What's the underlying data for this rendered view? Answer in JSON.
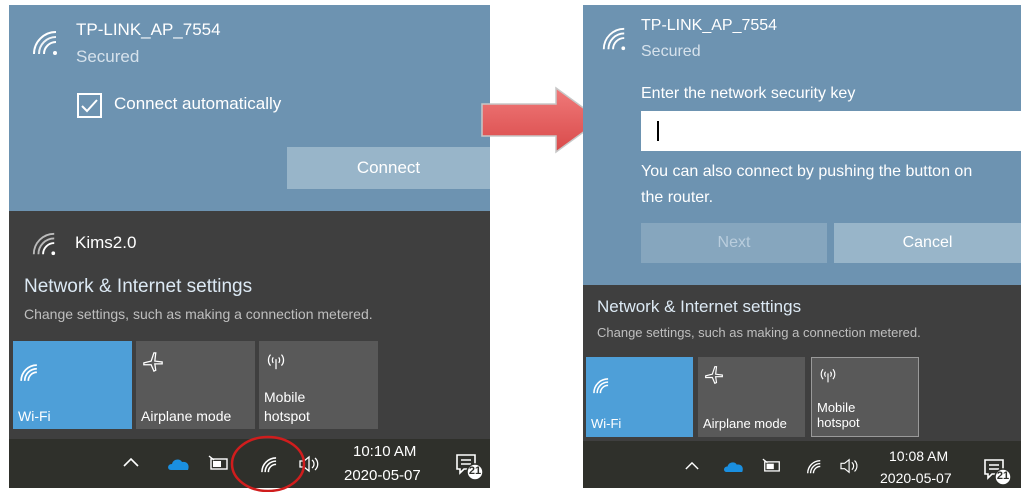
{
  "left": {
    "network_name": "TP-LINK_AP_7554",
    "network_status": "Secured",
    "connect_auto_label": "Connect automatically",
    "connect_button": "Connect",
    "other_network": "Kims2.0",
    "settings_title": "Network & Internet settings",
    "settings_desc": "Change settings, such as making a connection metered.",
    "tiles": [
      "Wi-Fi",
      "Airplane mode",
      "Mobile",
      "hotspot"
    ],
    "time": "10:10 AM",
    "date": "2020-05-07",
    "notifications_count": "21"
  },
  "right": {
    "network_name": "TP-LINK_AP_7554",
    "network_status": "Secured",
    "prompt": "Enter the network security key",
    "key_value": "",
    "hint_line1": "You can also connect by pushing the button on",
    "hint_line2": "the router.",
    "next_button": "Next",
    "cancel_button": "Cancel",
    "settings_title": "Network & Internet settings",
    "settings_desc": "Change settings, such as making a connection metered.",
    "tiles": [
      "Wi-Fi",
      "Airplane mode",
      "Mobile",
      "hotspot"
    ],
    "time": "10:08 AM",
    "date": "2020-05-07",
    "notifications_count": "21"
  },
  "colors": {
    "flyout_blue": "#6d93b1",
    "flyout_dark": "#3f3f3f",
    "tile_active": "#4e9fd8",
    "taskbar": "#2f302b",
    "arrow": "#e35b5b",
    "highlight_circle": "#d01d1d"
  },
  "icons": [
    "wifi-icon",
    "checkbox-icon",
    "airplane-icon",
    "hotspot-icon",
    "chevron-up-icon",
    "onedrive-icon",
    "battery-icon",
    "volume-icon",
    "notification-icon",
    "arrow-right-icon"
  ]
}
